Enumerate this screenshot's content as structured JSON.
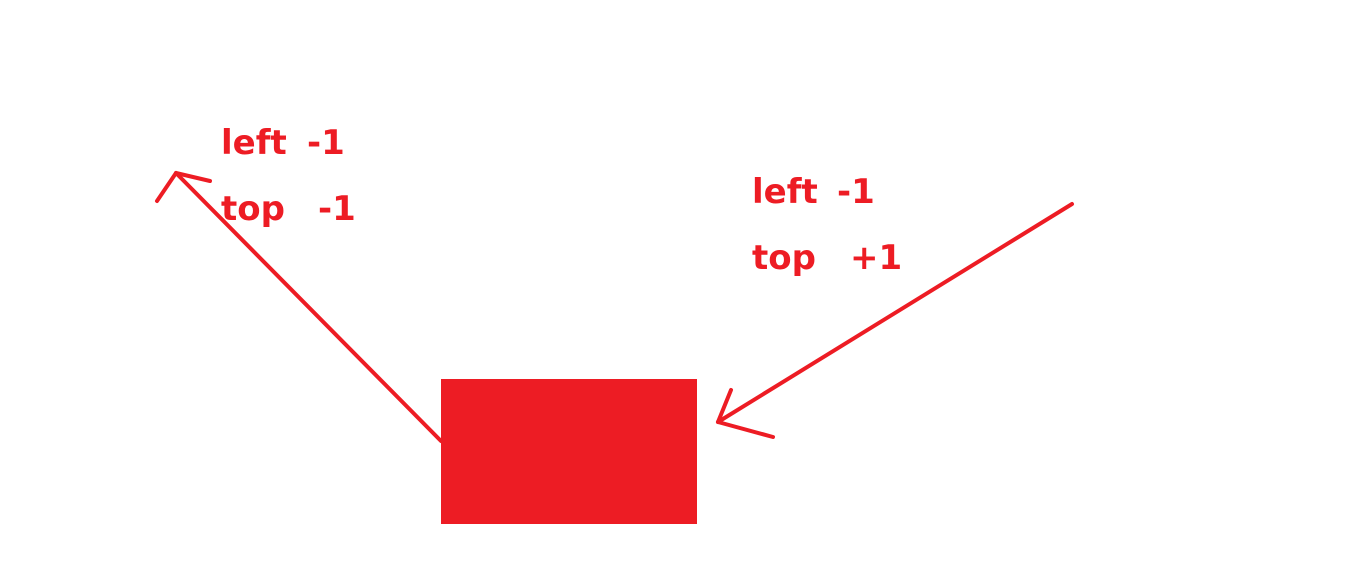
{
  "colors": {
    "accent": "#ed1c24",
    "background": "#ffffff"
  },
  "labels": {
    "left_group": {
      "left_label": "left",
      "left_value": "-1",
      "top_label": "top",
      "top_value": "-1"
    },
    "right_group": {
      "left_label": "left",
      "left_value": "-1",
      "top_label": "top",
      "top_value": "+1"
    }
  }
}
